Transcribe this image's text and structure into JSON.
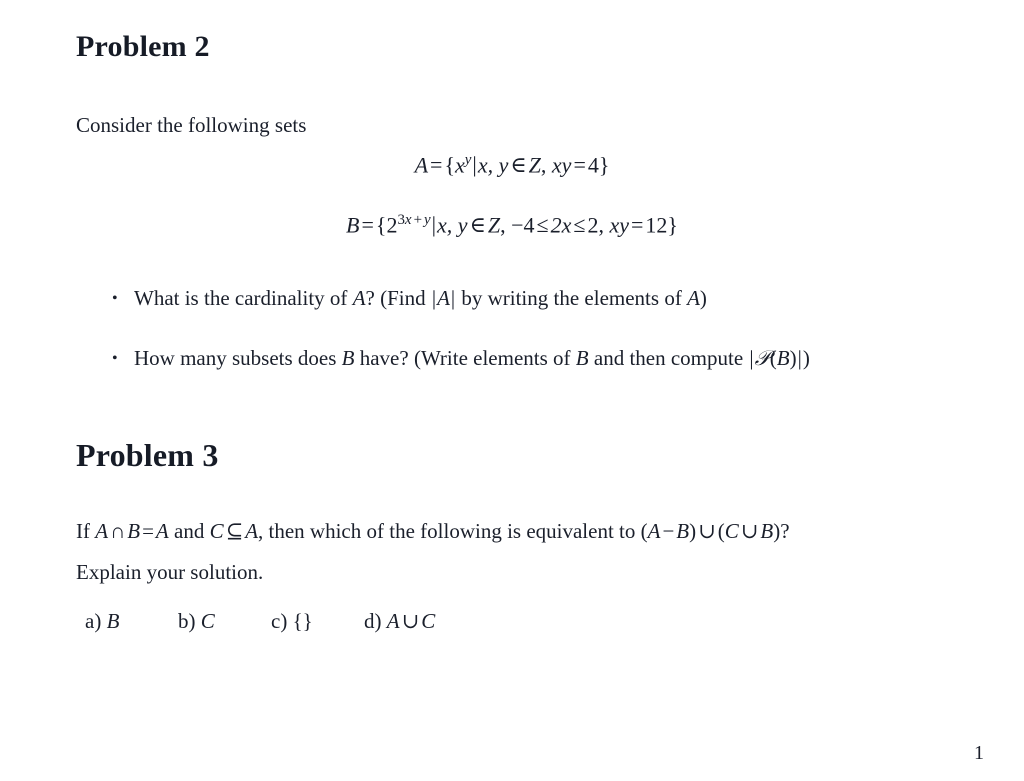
{
  "document": {
    "page_number": "1",
    "background_color": "#ffffff",
    "text_color": "#1a1f2b"
  },
  "problem2": {
    "heading": "Problem 2",
    "intro": "Consider the following sets",
    "equations": [
      {
        "name": "set-a-definition",
        "plain": "A = {x^y | x, y ∈ Z, xy = 4}",
        "parts": {
          "lhs": "A",
          "eq": "=",
          "open_brace": "{",
          "base": "x",
          "exponent": "y",
          "mid_bar": "|",
          "vars": "x, y",
          "in": "∈",
          "domain": "Z",
          "comma": ",",
          "condition_lhs": "xy",
          "condition_eq": "=",
          "condition_rhs": "4",
          "close_brace": "}"
        }
      },
      {
        "name": "set-b-definition",
        "plain": "B = {2^(3x+y) | x, y ∈ Z, −4 ≤ 2x ≤ 2, xy = 12}",
        "parts": {
          "lhs": "B",
          "eq": "=",
          "open_brace": "{",
          "base": "2",
          "exp_coef": "3",
          "exp_var1": "x",
          "exp_plus": "+",
          "exp_var2": "y",
          "mid_bar": "|",
          "vars": "x, y",
          "in": "∈",
          "domain": "Z",
          "comma1": ",",
          "range_low": "−4",
          "le1": "≤",
          "range_mid": "2x",
          "le2": "≤",
          "range_high": "2",
          "comma2": ",",
          "condition_lhs": "xy",
          "condition_eq": "=",
          "condition_rhs": "12",
          "close_brace": "}"
        }
      }
    ],
    "bullets": [
      {
        "marker": "•",
        "plain": "What is the cardinality of A? (Find |A| by writing the elements of A)",
        "segments": {
          "s1": "What is the cardinality of ",
          "var1": "A",
          "s2": "? (Find ",
          "bar1": "|",
          "var2": "A",
          "bar2": "|",
          "s3": " by writing the elements of ",
          "var3": "A",
          "s4": ")"
        }
      },
      {
        "marker": "•",
        "plain": "How many subsets does B have? (Write elements of B and then compute |P(B)|)",
        "segments": {
          "s1": "How many subsets does ",
          "var1": "B",
          "s2": " have? (Write elements of ",
          "var2": "B",
          "s3": " and then compute ",
          "bar1": "|",
          "powerset": "𝒫",
          "paren_open": "(",
          "var3": "B",
          "paren_close": ")",
          "bar2": "|",
          "s4": ")"
        }
      }
    ]
  },
  "problem3": {
    "heading": "Problem 3",
    "line1": {
      "plain": "If A ∩ B = A and C ⊆ A, then which of the following is equivalent to (A − B) ∪ (C ∪ B)?",
      "segments": {
        "s0": "If ",
        "var_a1": "A",
        "cap": "∩",
        "var_b1": "B",
        "eq": "=",
        "var_a2": "A",
        "s1": " and ",
        "var_c1": "C",
        "subseteq": "⊆",
        "var_a3": "A",
        "s2": ", then which of the following is equivalent to ",
        "paren1_open": "(",
        "var_a4": "A",
        "minus": "−",
        "var_b2": "B",
        "paren1_close": ")",
        "cup1": "∪",
        "paren2_open": "(",
        "var_c2": "C",
        "cup2": "∪",
        "var_b3": "B",
        "paren2_close": ")",
        "question": "?"
      }
    },
    "line2": "Explain your solution.",
    "choices": [
      {
        "label": "a)",
        "value": "B",
        "plain": "a) B"
      },
      {
        "label": "b)",
        "value": "C",
        "plain": "b) C"
      },
      {
        "label": "c)",
        "value": "{}",
        "plain": "c) {}"
      },
      {
        "label": "d)",
        "value": "A ∪ C",
        "plain": "d) A ∪ C",
        "parts": {
          "var1": "A",
          "cup": "∪",
          "var2": "C"
        }
      }
    ]
  }
}
